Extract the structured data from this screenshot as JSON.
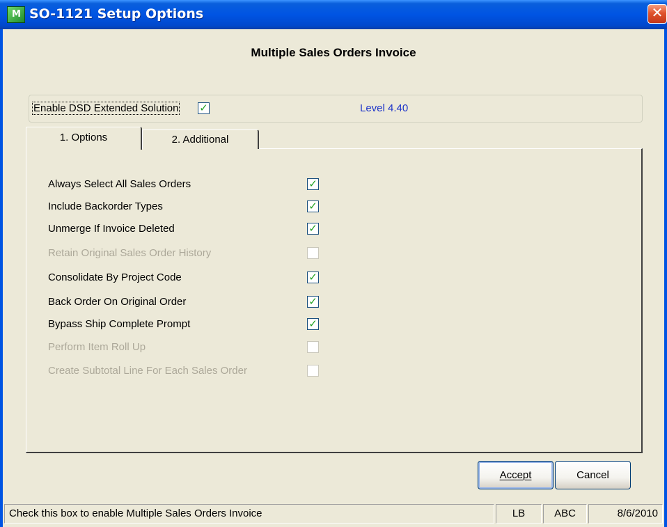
{
  "window": {
    "title": "SO-1121 Setup Options",
    "app_icon": "mas-app-icon",
    "close_label": "✕"
  },
  "heading": "Multiple Sales Orders Invoice",
  "enable": {
    "label": "Enable DSD Extended Solution",
    "checked": true,
    "level": "Level  4.40"
  },
  "tabs": [
    {
      "label": "1. Options",
      "active": true
    },
    {
      "label": "2. Additional",
      "active": false
    }
  ],
  "options": [
    {
      "label": "Always Select All Sales Orders",
      "checked": true,
      "enabled": true
    },
    {
      "label": "Include Backorder Types",
      "checked": true,
      "enabled": true
    },
    {
      "label": "Unmerge If Invoice Deleted",
      "checked": true,
      "enabled": true
    },
    {
      "label": "Retain Original Sales Order History",
      "checked": false,
      "enabled": false
    },
    {
      "label": "Consolidate By Project Code",
      "checked": true,
      "enabled": true
    },
    {
      "label": "Back Order On Original Order",
      "checked": true,
      "enabled": true
    },
    {
      "label": "Bypass Ship Complete Prompt",
      "checked": true,
      "enabled": true
    },
    {
      "label": "Perform Item Roll Up",
      "checked": false,
      "enabled": false
    },
    {
      "label": "Create Subtotal Line For Each Sales Order",
      "checked": false,
      "enabled": false
    }
  ],
  "buttons": {
    "accept_label": "Accept",
    "cancel_label": "Cancel"
  },
  "status": {
    "message": "Check this box to enable Multiple Sales Orders Invoice",
    "user": "LB",
    "company": "ABC",
    "date": "8/6/2010"
  },
  "colors": {
    "title_bar": "#0054e3",
    "level_text": "#1d34c9",
    "check_mark": "#21a121",
    "disabled_text": "#aca899"
  }
}
